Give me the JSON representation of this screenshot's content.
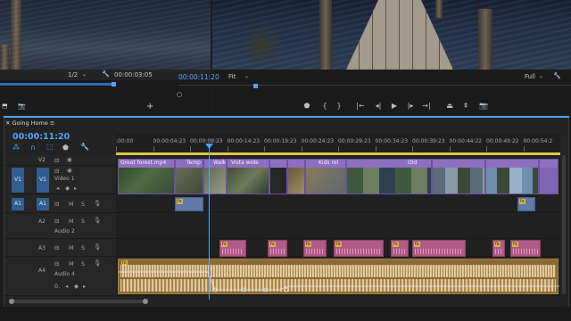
{
  "source_monitor": {
    "zoom": "1/2",
    "timecode": "00:00:03:05"
  },
  "program_monitor": {
    "timecode": "00:00:11:20",
    "fit": "Fit",
    "quality": "Full"
  },
  "timeline": {
    "sequence_name": "Going Home",
    "timecode": "00:00:11:20",
    "ruler": [
      ":00:00",
      "00:00:04:23",
      "00:00:09:23",
      "00:00:14:23",
      "00:00:19:23",
      "00:00:24:23",
      "00:00:29:23",
      "00:00:34:23",
      "00:00:39:23",
      "00:00:44:22",
      "00:00:49:22",
      "00:00:54:2"
    ],
    "tracks": {
      "v2": "V2",
      "v1": "V1",
      "v1_src": "V1",
      "video1": "Video 1",
      "a1": "A1",
      "a1_src": "A1",
      "a2": "A2",
      "audio2": "Audio 2",
      "a3": "A3",
      "a4": "A4",
      "audio4": "Audio 4",
      "m": "M",
      "s": "S",
      "vol": "0."
    },
    "clips": {
      "c1": "Great forest.mp4",
      "c2": "Temp",
      "c3": "Walk",
      "c4": "Vista wide",
      "c5": "Kids rol",
      "c6": "Old"
    },
    "fx_badge": "fx"
  },
  "icons": {
    "wrench": "wrench-icon",
    "camera": "camera-icon",
    "play": "play-icon",
    "marker": "marker-icon"
  },
  "colors": {
    "accent": "#4fa3ff",
    "video_clip": "#8d6fbf",
    "audio_clip": "#b05a86",
    "music_clip": "#c8a14a"
  }
}
